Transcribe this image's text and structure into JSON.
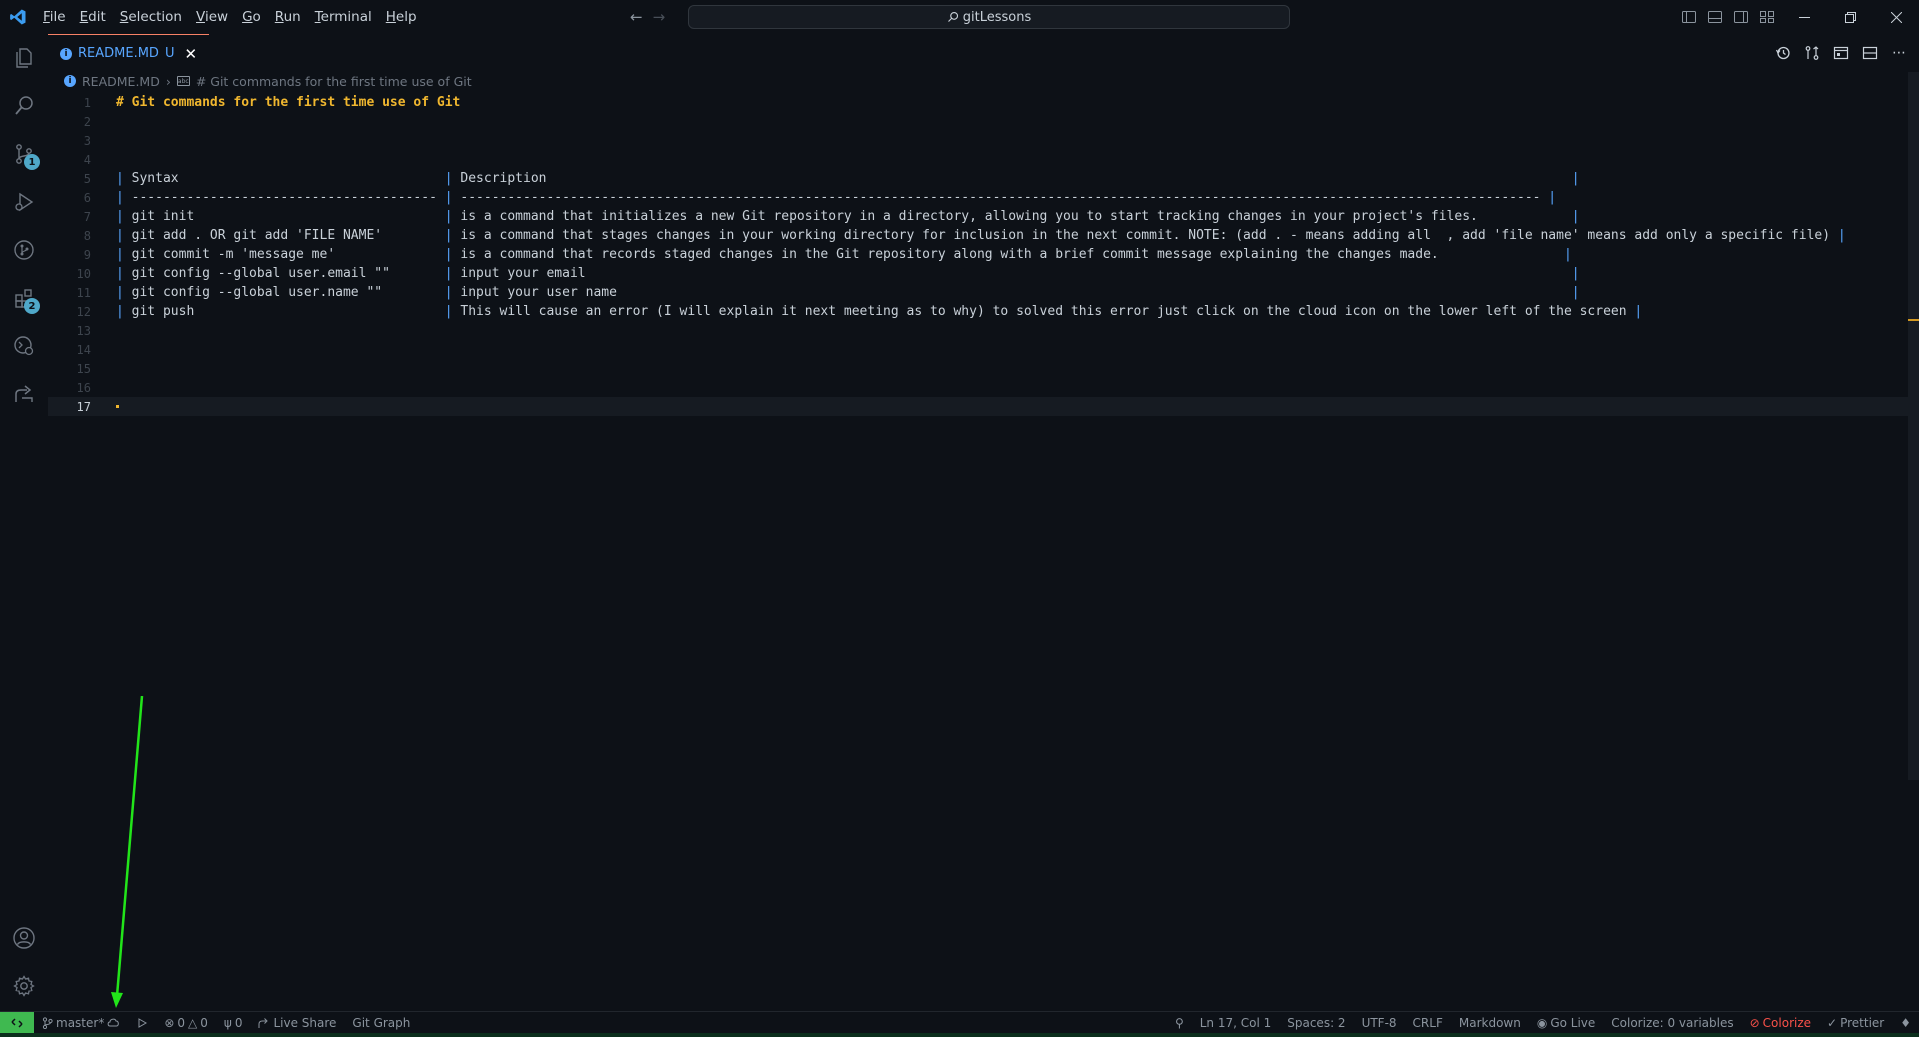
{
  "menu": [
    "File",
    "Edit",
    "Selection",
    "View",
    "Go",
    "Run",
    "Terminal",
    "Help"
  ],
  "menu_underline": [
    "F",
    "E",
    "S",
    "V",
    "G",
    "R",
    "T",
    "H"
  ],
  "search": {
    "text": "gitLessons"
  },
  "tab": {
    "label": "README.MD",
    "status": "U",
    "icon_letter": "i"
  },
  "breadcrumb": {
    "file": "README.MD",
    "section": "# Git commands for the first time use of Git"
  },
  "activity_badges": {
    "scm": "1",
    "extensions": "2"
  },
  "editor": {
    "current_line": 17,
    "lines": [
      {
        "n": "1",
        "text": "# Git commands for the first time use of Git",
        "kind": "heading"
      },
      {
        "n": "2",
        "text": ""
      },
      {
        "n": "3",
        "text": ""
      },
      {
        "n": "4",
        "text": ""
      },
      {
        "n": "5",
        "text": "| Syntax                                  | Description                                                                                                                                   |"
      },
      {
        "n": "6",
        "text": "| --------------------------------------- | ------------------------------------------------------------------------------------------------------------------------------------------ |"
      },
      {
        "n": "7",
        "text": "| git init                                | is a command that initializes a new Git repository in a directory, allowing you to start tracking changes in your project's files.            |"
      },
      {
        "n": "8",
        "text": "| git add . OR git add 'FILE NAME'        | is a command that stages changes in your working directory for inclusion in the next commit. NOTE: (add . - means adding all  , add 'file name' means add only a specific file) |"
      },
      {
        "n": "9",
        "text": "| git commit -m 'message me'              | is a command that records staged changes in the Git repository along with a brief commit message explaining the changes made.                |"
      },
      {
        "n": "10",
        "text": "| git config --global user.email \"\"       | input your email                                                                                                                              |"
      },
      {
        "n": "11",
        "text": "| git config --global user.name \"\"        | input your user name                                                                                                                          |"
      },
      {
        "n": "12",
        "text": "| git push                                | This will cause an error (I will explain it next meeting as to why) to solved this error just click on the cloud icon on the lower left of the screen |"
      },
      {
        "n": "13",
        "text": ""
      },
      {
        "n": "14",
        "text": ""
      },
      {
        "n": "15",
        "text": ""
      },
      {
        "n": "16",
        "text": ""
      },
      {
        "n": "17",
        "text": ""
      }
    ],
    "table": {
      "header": [
        "Syntax",
        "Description"
      ],
      "rows": [
        [
          "git init",
          "is a command that initializes a new Git repository in a directory, allowing you to start tracking changes in your project's files."
        ],
        [
          "git add . OR git add 'FILE NAME'",
          "is a command that stages changes in your working directory for inclusion in the next commit. NOTE: (add . - means adding all  , add 'file name' means add only a specific file)"
        ],
        [
          "git commit -m 'message me'",
          "is a command that records staged changes in the Git repository along with a brief commit message explaining the changes made."
        ],
        [
          "git config --global user.email \"\"",
          "input your email"
        ],
        [
          "git config --global user.name \"\"",
          "input your user name"
        ],
        [
          "git push",
          "This will cause an error (I will explain it next meeting as to why) to solved this error just click on the cloud icon on the lower left of the screen"
        ]
      ]
    }
  },
  "status": {
    "branch": "master*",
    "errors": "0",
    "warnings": "0",
    "ports": "0",
    "live_share": "Live Share",
    "git_graph": "Git Graph",
    "position": "Ln 17, Col 1",
    "spaces": "Spaces: 2",
    "encoding": "UTF-8",
    "eol": "CRLF",
    "language": "Markdown",
    "go_live": "Go Live",
    "colorize_vars": "Colorize: 0 variables",
    "colorize": "Colorize",
    "prettier": "Prettier"
  },
  "colors": {
    "background": "#0d1117",
    "accent_blue": "#58a6ff",
    "heading_yellow": "#f0b72f",
    "remote_green": "#3fb950",
    "annotation_green": "#22e51a",
    "error_red": "#f85149"
  },
  "icons": {
    "activity": [
      "explorer-icon",
      "search-icon",
      "source-control-icon",
      "run-debug-icon",
      "git-graph-icon",
      "extensions-icon",
      "remote-explorer-icon",
      "live-share-icon",
      "account-icon",
      "gear-icon"
    ]
  }
}
